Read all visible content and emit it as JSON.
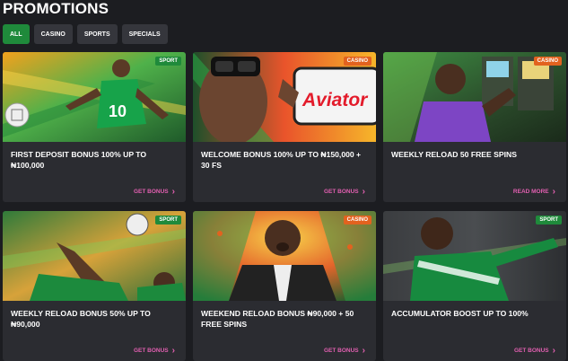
{
  "page": {
    "title": "PROMOTIONS"
  },
  "filters": [
    {
      "label": "ALL",
      "active": true
    },
    {
      "label": "CASINO",
      "active": false
    },
    {
      "label": "SPORTS",
      "active": false
    },
    {
      "label": "SPECIALS",
      "active": false
    }
  ],
  "cards": [
    {
      "badge": "SPORT",
      "title": "FIRST DEPOSIT BONUS 100% UP TO ₦100,000",
      "cta": "GET BONUS"
    },
    {
      "badge": "CASINO",
      "title": "WELCOME BONUS 100% UP TO ₦150,000 + 30 FS",
      "cta": "GET BONUS",
      "image_text": "Aviator"
    },
    {
      "badge": "CASINO",
      "title": "WEEKLY RELOAD 50 FREE SPINS",
      "cta": "READ MORE"
    },
    {
      "badge": "SPORT",
      "title": "WEEKLY RELOAD BONUS 50% UP TO ₦90,000",
      "cta": "GET BONUS"
    },
    {
      "badge": "CASINO",
      "title": "WEEKEND RELOAD BONUS ₦90,000 + 50 FREE SPINS",
      "cta": "GET BONUS"
    },
    {
      "badge": "SPORT",
      "title": "ACCUMULATOR BOOST UP TO 100%",
      "cta": "GET BONUS"
    }
  ],
  "colors": {
    "background": "#1c1d21",
    "card": "#2b2c31",
    "sport_badge": "#1f8a3b",
    "casino_badge": "#e2621f",
    "cta": "#e15fb0"
  },
  "icons": {
    "cta_arrow": "chevron-right-icon"
  }
}
